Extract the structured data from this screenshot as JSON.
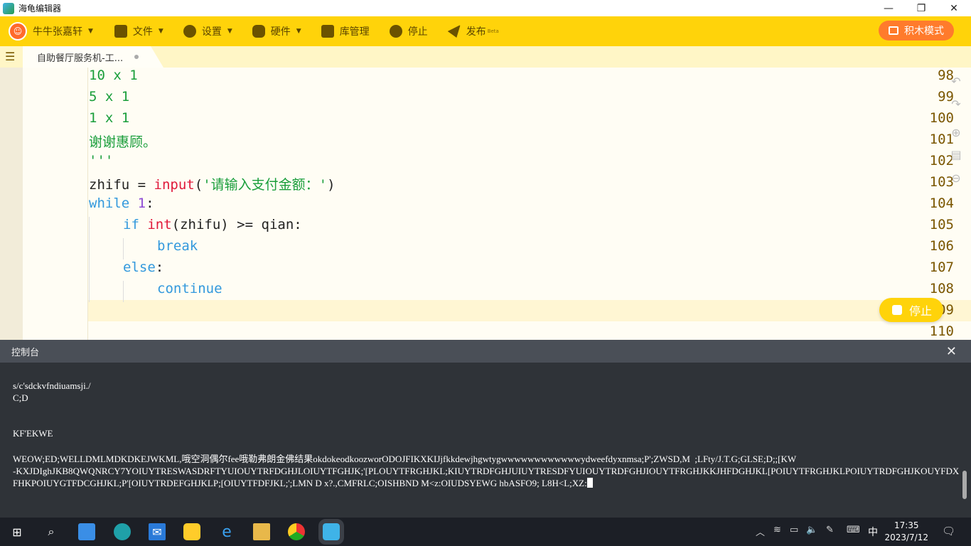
{
  "window": {
    "title": "海龟编辑器"
  },
  "toolbar": {
    "user": "牛牛张嘉轩",
    "file": "文件",
    "settings": "设置",
    "hardware": "硬件",
    "library": "库管理",
    "stop": "停止",
    "publish": "发布",
    "publish_badge": "Beta",
    "mode": "积木模式"
  },
  "tab": {
    "label": "自助餐厅服务机-工..."
  },
  "editor": {
    "lines": [
      {
        "num": "98",
        "text": "10 x 1"
      },
      {
        "num": "99",
        "text": "5 x 1"
      },
      {
        "num": "100",
        "text": "1 x 1"
      },
      {
        "num": "101",
        "text": "谢谢惠顾。"
      },
      {
        "num": "102",
        "text": "'''"
      },
      {
        "num": "103",
        "var": "zhifu",
        "op": " = ",
        "fn": "input",
        "p1": "(",
        "str": "'请输入支付金额：'",
        "p2": ")"
      },
      {
        "num": "104",
        "kw": "while",
        "sp": " ",
        "n": "1",
        "rest": ":"
      },
      {
        "num": "105",
        "kw": "if",
        "sp": " ",
        "fn": "int",
        "rest": "(zhifu) >= qian:"
      },
      {
        "num": "106",
        "kw": "break"
      },
      {
        "num": "107",
        "kw": "else",
        "rest": ":"
      },
      {
        "num": "108",
        "kw": "continue"
      },
      {
        "num": "109"
      },
      {
        "num": "110"
      }
    ],
    "stop_button": "停止"
  },
  "console": {
    "title": "控制台",
    "lines": [
      "s/c'sdckvfndiuamsji./",
      "C;D",
      "",
      "",
      "KF'EKWE",
      "",
      "WEOW;ED;WELLDMLMDKDKEJWKML,哦空洞偶尔fee哦勒弗朗金佛结果okdokeodkoozworODOJFIKXKIJjfkkdewjhgwtygwwwwwwwwwwwwydweefdyxnmsa;P';ZWSD,M  ;LFty/J.T.G;GLSE;D;;[KW",
      "-KXJDIghJKB8QWQNRCY7YOIUYTRESWASDRFTYUIOUYTRFDGHJLOIUYTFGHJK;'[PLOUYTFRGHJKL;KIUYTRDFGHJUIUYTRESDFYUIOUYTRDFGHJIOUYTFRGHJKKJHFDGHJKL[POIUYTFRGHJKLPOIUYTRDFGHJKOUYFDXFHKPOIUYGTFDCGHJKL;P'[OIUYTRDEFGHJKLP;[OIUYTFDFJKL;';LMN D x?.,CMFRLC;OISHBND M<z:OIUDSYEWG hbASFO9; L8H<L;XZ:"
    ]
  },
  "taskbar": {
    "ime": "中",
    "time": "17:35",
    "date": "2023/7/12"
  },
  "colors": {
    "toolbar_bg": "#ffd30a",
    "mode_button": "#ff7b2c",
    "keyword": "#3399dd",
    "builtin": "#e0193a",
    "string": "#1a9e3b",
    "number": "#8d4ad4",
    "console_bg": "#2f3338"
  }
}
